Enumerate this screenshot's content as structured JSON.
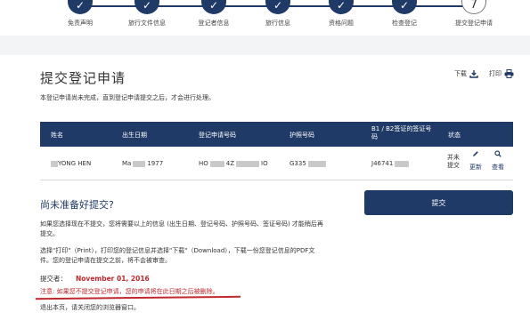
{
  "steps": [
    {
      "label": "免责声明",
      "mark": "✓"
    },
    {
      "label": "旅行文件信息",
      "mark": "✓"
    },
    {
      "label": "登记者信息",
      "mark": "✓"
    },
    {
      "label": "旅行信息",
      "mark": "✓"
    },
    {
      "label": "资格问题",
      "mark": "✓"
    },
    {
      "label": "检查登记",
      "mark": "✓"
    },
    {
      "label": "提交登记申请",
      "mark": "7"
    }
  ],
  "header": {
    "title": "提交登记申请",
    "download_label": "下载",
    "print_label": "打印",
    "notice": "本登记申请尚未完成，直到登记申请提交之后，才会进行处理。"
  },
  "table": {
    "columns": {
      "name": "姓名",
      "dob": "出生日期",
      "app_no": "登记申请号码",
      "passport": "护照号码",
      "visa_line1": "B1 / B2签证的签证号",
      "visa_line2": "码",
      "status": "状态"
    },
    "row": {
      "name": "YONG HEN",
      "dob_prefix": "Ma",
      "dob_suffix": "1977",
      "app_prefix": "HO",
      "app_mid": "4Z",
      "app_suffix": "IO",
      "passport_prefix": "G335",
      "visa_prefix": "J46741",
      "status": "并未提交",
      "edit_label": "更新",
      "view_label": "查看"
    }
  },
  "left": {
    "not_ready_title": "尚未准备好提交?",
    "para1": "如果您选择现在不提交，您将需要以上的信息 (出生日期、登记号码、护照号码、签证号码) 才能稍后再提交。",
    "para2": "选择\"打印\"（Print），打印您的登记信息并选择\"下载\"（Download），下载一份您登记信息的PDF文件。您的登记申请在提交之前，将不会被审查。",
    "submitter_label": "提交者：",
    "submit_date": "November 01, 2016",
    "note": "注意: 如果您不提交登记申请，您的申请将在此日期之后被删除。",
    "exit_text": "退出本页，请关闭您的浏览器窗口。"
  },
  "submit_button": "提交",
  "colors": {
    "navy": "#1f3a66",
    "red": "#c0282d"
  }
}
